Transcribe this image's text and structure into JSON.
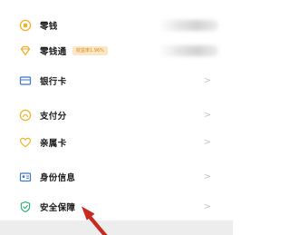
{
  "menu": {
    "items": [
      {
        "label": "零钱",
        "icon": "coin-icon"
      },
      {
        "label": "零钱通",
        "icon": "diamond-icon",
        "badge": "收益率1.96%"
      },
      {
        "label": "银行卡",
        "icon": "card-icon"
      },
      {
        "label": "支付分",
        "icon": "score-icon"
      },
      {
        "label": "亲属卡",
        "icon": "heart-card-icon"
      },
      {
        "label": "身份信息",
        "icon": "id-icon"
      },
      {
        "label": "安全保障",
        "icon": "shield-icon"
      }
    ],
    "chevron": ">"
  },
  "colors": {
    "icon_gold": "#f2b22b",
    "icon_blue": "#3e78c7",
    "icon_green": "#2bb673",
    "arrow_red": "#c82a20"
  }
}
